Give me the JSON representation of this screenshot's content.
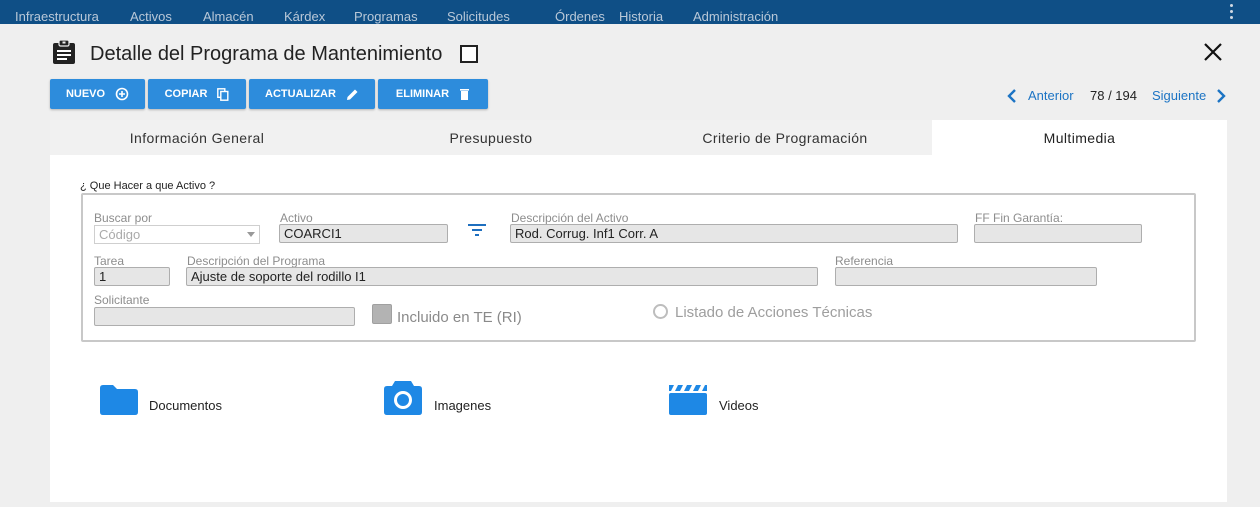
{
  "nav": {
    "items": [
      "Infraestructura",
      "Activos",
      "Almacén",
      "Kárdex",
      "Programas",
      "Solicitudes",
      "Órdenes",
      "Historia",
      "Administración"
    ]
  },
  "header": {
    "title": "Detalle del Programa de Mantenimiento",
    "icon": "clipboard-icon"
  },
  "toolbar": {
    "nuevo": "NUEVO",
    "copiar": "COPIAR",
    "actualizar": "ACTUALIZAR",
    "eliminar": "ELIMINAR"
  },
  "pager": {
    "prev": "Anterior",
    "count": "78 / 194",
    "next": "Siguiente"
  },
  "tabs": [
    "Información General",
    "Presupuesto",
    "Criterio de Programación",
    "Multimedia"
  ],
  "active_tab": "Multimedia",
  "form": {
    "section_label": "¿ Que Hacer a que Activo ?",
    "buscar_por": {
      "label": "Buscar por",
      "placeholder": "Código"
    },
    "activo": {
      "label": "Activo",
      "value": "COARCI1"
    },
    "descripcion_activo": {
      "label": "Descripción del Activo",
      "value": "Rod. Corrug. Inf1 Corr. A"
    },
    "ff_fin_garantia": {
      "label": "FF Fin Garantía:",
      "value": ""
    },
    "tarea": {
      "label": "Tarea",
      "value": "1"
    },
    "descripcion_programa": {
      "label": "Descripción del Programa",
      "value": "Ajuste de soporte del rodillo I1"
    },
    "referencia": {
      "label": "Referencia",
      "value": ""
    },
    "solicitante": {
      "label": "Solicitante",
      "value": ""
    },
    "incluido_te": "Incluido en TE (RI)",
    "listado_acciones": "Listado de Acciones Técnicas"
  },
  "multimedia": {
    "documentos": "Documentos",
    "imagenes": "Imagenes",
    "videos": "Videos"
  },
  "colors": {
    "nav_bg": "#0f4f86",
    "button": "#2d8cdc",
    "link": "#1c74c4",
    "media_icon": "#1e88e5"
  }
}
